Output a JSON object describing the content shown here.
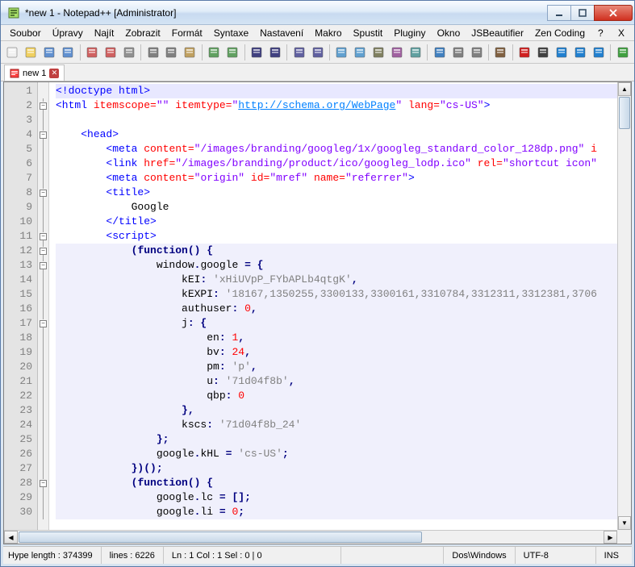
{
  "window": {
    "title": "*new 1 - Notepad++ [Administrator]"
  },
  "menu": {
    "items": [
      "Soubor",
      "Úpravy",
      "Najít",
      "Zobrazit",
      "Formát",
      "Syntaxe",
      "Nastavení",
      "Makro",
      "Spustit",
      "Pluginy",
      "Okno",
      "JSBeautifier",
      "Zen Coding",
      "?"
    ],
    "close_x": "X"
  },
  "tabs": {
    "items": [
      {
        "label": "new 1"
      }
    ]
  },
  "code": {
    "line_start": 1,
    "lines": [
      {
        "n": 1,
        "fold": "",
        "hl": true,
        "html": "<span class='t-tag'>&lt;!doctype html&gt;</span>"
      },
      {
        "n": 2,
        "fold": "box",
        "html": "<span class='t-tag'>&lt;html</span> <span class='t-attr'>itemscope=</span><span class='t-val'>\"\"</span> <span class='t-attr'>itemtype=</span><span class='t-val'>\"</span><span class='t-link'>http://schema.org/WebPage</span><span class='t-val'>\"</span> <span class='t-attr'>lang=</span><span class='t-val'>\"cs-US\"</span><span class='t-tag'>&gt;</span>"
      },
      {
        "n": 3,
        "fold": "line",
        "html": ""
      },
      {
        "n": 4,
        "fold": "box",
        "html": "    <span class='t-tag'>&lt;head&gt;</span>"
      },
      {
        "n": 5,
        "fold": "line",
        "html": "        <span class='t-tag'>&lt;meta</span> <span class='t-attr'>content=</span><span class='t-val'>\"/images/branding/googleg/1x/googleg_standard_color_128dp.png\"</span> <span class='t-attr'>i</span>"
      },
      {
        "n": 6,
        "fold": "line",
        "html": "        <span class='t-tag'>&lt;link</span> <span class='t-attr'>href=</span><span class='t-val'>\"/images/branding/product/ico/googleg_lodp.ico\"</span> <span class='t-attr'>rel=</span><span class='t-val'>\"shortcut icon\"</span>"
      },
      {
        "n": 7,
        "fold": "line",
        "html": "        <span class='t-tag'>&lt;meta</span> <span class='t-attr'>content=</span><span class='t-val'>\"origin\"</span> <span class='t-attr'>id=</span><span class='t-val'>\"mref\"</span> <span class='t-attr'>name=</span><span class='t-val'>\"referrer\"</span><span class='t-tag'>&gt;</span>"
      },
      {
        "n": 8,
        "fold": "box",
        "html": "        <span class='t-tag'>&lt;title&gt;</span>"
      },
      {
        "n": 9,
        "fold": "line",
        "html": "            Google"
      },
      {
        "n": 10,
        "fold": "line",
        "html": "        <span class='t-tag'>&lt;/title&gt;</span>"
      },
      {
        "n": 11,
        "fold": "box",
        "html": "        <span class='t-tag'>&lt;script&gt;</span>"
      },
      {
        "n": 12,
        "fold": "box",
        "hl2": true,
        "html": "            <span class='t-op'>(</span><span class='t-kw'>function</span><span class='t-op'>() {</span>"
      },
      {
        "n": 13,
        "fold": "box",
        "hl2": true,
        "html": "                window<span class='t-op'>.</span>google <span class='t-op'>= {</span>"
      },
      {
        "n": 14,
        "fold": "line",
        "hl2": true,
        "html": "                    kEI<span class='t-op'>:</span> <span class='t-str'>'xHiUVpP_FYbAPLb4qtgK'</span><span class='t-op'>,</span>"
      },
      {
        "n": 15,
        "fold": "line",
        "hl2": true,
        "html": "                    kEXPI<span class='t-op'>:</span> <span class='t-str'>'18167,1350255,3300133,3300161,3310784,3312311,3312381,3706</span>"
      },
      {
        "n": 16,
        "fold": "line",
        "hl2": true,
        "html": "                    authuser<span class='t-op'>:</span> <span class='t-num'>0</span><span class='t-op'>,</span>"
      },
      {
        "n": 17,
        "fold": "box",
        "hl2": true,
        "html": "                    j<span class='t-op'>: {</span>"
      },
      {
        "n": 18,
        "fold": "line",
        "hl2": true,
        "html": "                        en<span class='t-op'>:</span> <span class='t-num'>1</span><span class='t-op'>,</span>"
      },
      {
        "n": 19,
        "fold": "line",
        "hl2": true,
        "html": "                        bv<span class='t-op'>:</span> <span class='t-num'>24</span><span class='t-op'>,</span>"
      },
      {
        "n": 20,
        "fold": "line",
        "hl2": true,
        "html": "                        pm<span class='t-op'>:</span> <span class='t-str'>'p'</span><span class='t-op'>,</span>"
      },
      {
        "n": 21,
        "fold": "line",
        "hl2": true,
        "html": "                        u<span class='t-op'>:</span> <span class='t-str'>'71d04f8b'</span><span class='t-op'>,</span>"
      },
      {
        "n": 22,
        "fold": "line",
        "hl2": true,
        "html": "                        qbp<span class='t-op'>:</span> <span class='t-num'>0</span>"
      },
      {
        "n": 23,
        "fold": "line",
        "hl2": true,
        "html": "                    <span class='t-op'>},</span>"
      },
      {
        "n": 24,
        "fold": "line",
        "hl2": true,
        "html": "                    kscs<span class='t-op'>:</span> <span class='t-str'>'71d04f8b_24'</span>"
      },
      {
        "n": 25,
        "fold": "line",
        "hl2": true,
        "html": "                <span class='t-op'>};</span>"
      },
      {
        "n": 26,
        "fold": "line",
        "hl2": true,
        "html": "                google<span class='t-op'>.</span>kHL <span class='t-op'>=</span> <span class='t-str'>'cs-US'</span><span class='t-op'>;</span>"
      },
      {
        "n": 27,
        "fold": "line",
        "hl2": true,
        "html": "            <span class='t-op'>})();</span>"
      },
      {
        "n": 28,
        "fold": "box",
        "hl2": true,
        "html": "            <span class='t-op'>(</span><span class='t-kw'>function</span><span class='t-op'>() {</span>"
      },
      {
        "n": 29,
        "fold": "line",
        "hl2": true,
        "html": "                google<span class='t-op'>.</span>lc <span class='t-op'>= [];</span>"
      },
      {
        "n": 30,
        "fold": "line",
        "hl2": true,
        "html": "                google<span class='t-op'>.</span>li <span class='t-op'>=</span> <span class='t-num'>0</span><span class='t-op'>;</span>"
      }
    ]
  },
  "status": {
    "length": "Hype length : 374399",
    "lines": "lines : 6226",
    "pos": "Ln : 1   Col : 1   Sel : 0 | 0",
    "eol": "Dos\\Windows",
    "enc": "UTF-8",
    "mode": "INS"
  },
  "toolbar_icons": [
    "new-file-icon",
    "open-file-icon",
    "save-icon",
    "save-all-icon",
    "sep",
    "close-icon",
    "close-all-icon",
    "print-icon",
    "sep",
    "cut-icon",
    "copy-icon",
    "paste-icon",
    "sep",
    "undo-icon",
    "redo-icon",
    "sep",
    "find-icon",
    "replace-icon",
    "sep",
    "zoom-in-icon",
    "zoom-out-icon",
    "sep",
    "sync-v-icon",
    "sync-h-icon",
    "wrap-icon",
    "chars-icon",
    "indent-icon",
    "sep",
    "lang-icon",
    "doc-map-icon",
    "func-list-icon",
    "sep",
    "fold-icon",
    "sep",
    "record-icon",
    "stop-icon",
    "play-icon",
    "play-multi-icon",
    "save-macro-icon",
    "sep",
    "monitor-icon"
  ]
}
